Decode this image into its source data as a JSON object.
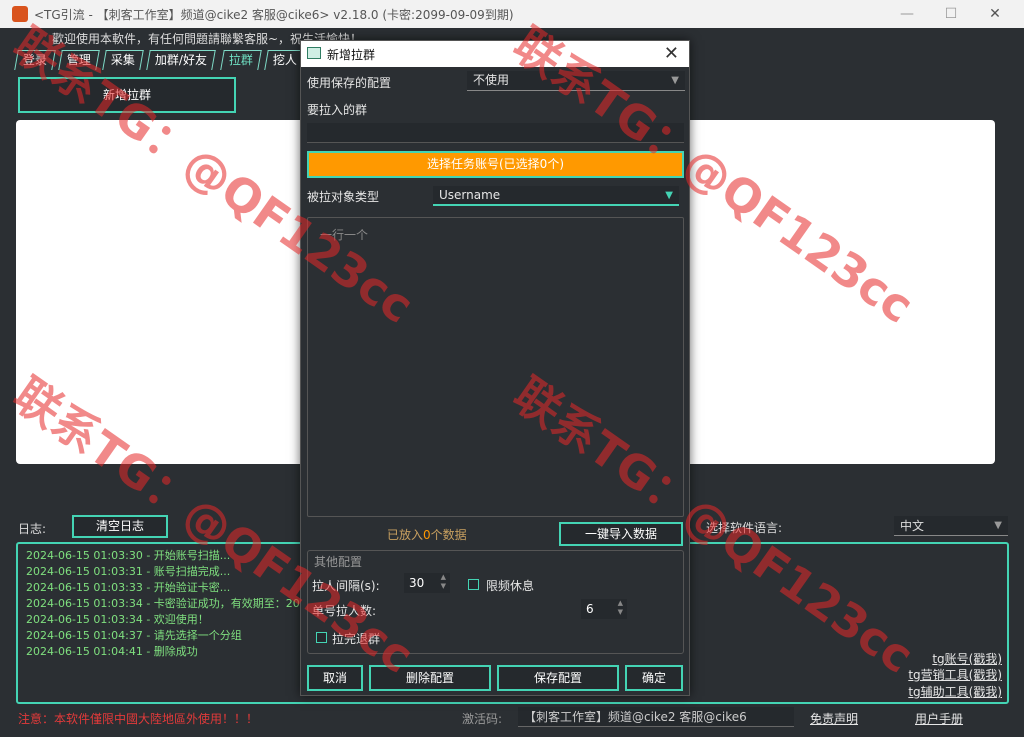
{
  "window": {
    "title": "<TG引流 - 【刺客工作室】频道@cike2 客服@cike6> v2.18.0 (卡密:2099-09-09到期)",
    "minimize": "—",
    "maximize": "☐",
    "close": "✕"
  },
  "welcome": "歡迎使用本軟件，有任何問題請聯繫客服~，祝生活愉快！",
  "tabs": [
    "登录",
    "管理",
    "采集",
    "加群/好友",
    "拉群",
    "挖人"
  ],
  "active_tab": "拉群",
  "add_group_button": "新增拉群",
  "log": {
    "label": "日志:",
    "clear_button": "清空日志",
    "lines": [
      "2024-06-15 01:03:30 - 开始账号扫描...",
      "2024-06-15 01:03:31 - 账号扫描完成...",
      "2024-06-15 01:03:33 - 开始验证卡密...",
      "2024-06-15 01:03:34 - 卡密验证成功，有效期至：2099-",
      "2024-06-15 01:03:34 - 欢迎使用！",
      "2024-06-15 01:04:37 - 请先选择一个分组",
      "2024-06-15 01:04:41 - 删除成功"
    ]
  },
  "language": {
    "label": "选择软件语言:",
    "value": "中文"
  },
  "links": [
    "tg账号(戳我)",
    "tg营销工具(戳我)",
    "tg辅助工具(戳我)"
  ],
  "footer": {
    "notice": "注意：本软件僅限中國大陸地區外使用！！！",
    "activation_label": "激活码:",
    "activation_value": "【刺客工作室】频道@cike2 客服@cike6",
    "disclaimer": "免责声明",
    "manual": "用户手册"
  },
  "dialog": {
    "title": "新增拉群",
    "saved_config_label": "使用保存的配置",
    "saved_config_value": "不使用",
    "target_group_label": "要拉入的群",
    "select_accounts_button": "选择任务账号(已选择0个)",
    "target_type_label": "被拉对象类型",
    "target_type_value": "Username",
    "textbox_placeholder": "一行一个",
    "loaded_count_prefix": "已放入",
    "loaded_count": "0",
    "loaded_count_suffix": "个数据",
    "import_button": "一键导入数据",
    "other_config_label": "其他配置",
    "interval_label": "拉人间隔(s):",
    "interval_value": "30",
    "rate_limit_rest_label": "限频休息",
    "per_account_label": "单号拉人数:",
    "per_account_value": "6",
    "leave_after_label": "拉完退群",
    "cancel_button": "取消",
    "delete_config_button": "删除配置",
    "save_config_button": "保存配置",
    "ok_button": "确定"
  },
  "watermark": "联系TG：@QF123cc",
  "colors": {
    "accent": "#44d4b4",
    "orange": "#ff9900",
    "log_text": "#7fe07f",
    "notice": "#e23a3a"
  }
}
